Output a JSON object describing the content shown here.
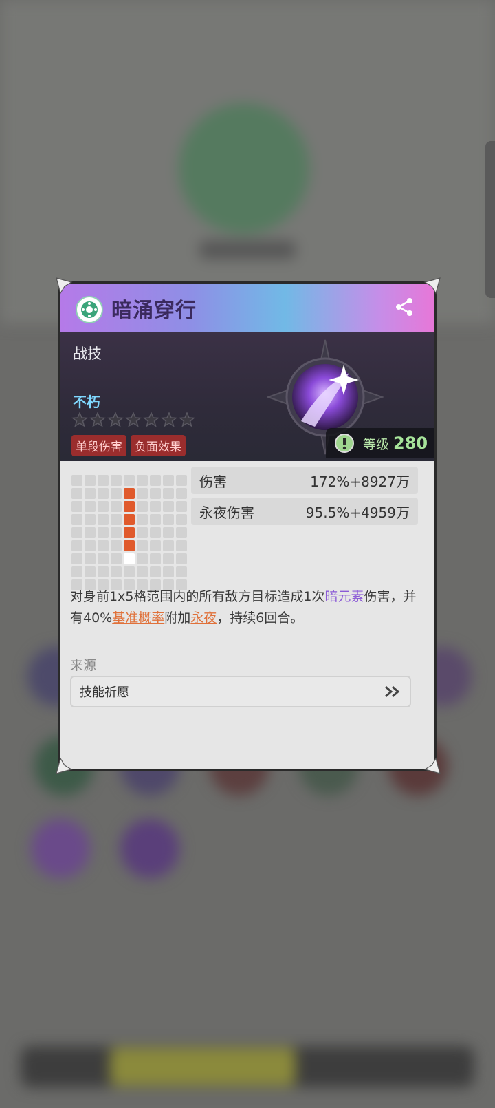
{
  "skill": {
    "name": "暗涌穿行",
    "type": "战技",
    "subtitle": "不朽",
    "stars_filled": 0,
    "stars_total": 7,
    "tags": [
      "单段伤害",
      "负面效果"
    ],
    "level_label": "等级",
    "level_value": "280"
  },
  "stats": [
    {
      "label": "伤害",
      "value": "172%+8927万"
    },
    {
      "label": "永夜伤害",
      "value": "95.5%+4959万"
    }
  ],
  "range_grid": {
    "cols": 9,
    "rows": 9,
    "hit_cells": [
      [
        4,
        1
      ],
      [
        4,
        2
      ],
      [
        4,
        3
      ],
      [
        4,
        4
      ],
      [
        4,
        5
      ]
    ],
    "self_cell": [
      4,
      6
    ]
  },
  "description": {
    "p1": "对身前1x5格范围内的所有敌方目标造成1次",
    "element": "暗元素",
    "p2": "伤害，并有40%",
    "link1": "基准概率",
    "p3": "附加",
    "link2": "永夜",
    "p4": "，持续6回合。"
  },
  "source": {
    "label": "来源",
    "item": "技能祈愿"
  },
  "icons": {
    "title": "emblem-icon",
    "share": "share-icon",
    "level": "exclamation-icon",
    "source_arrow": "double-chevron-right-icon"
  },
  "colors": {
    "hit": "#e05a2c",
    "element": "#8b5ad6",
    "link": "#e0713a",
    "level": "#a6e39a"
  }
}
